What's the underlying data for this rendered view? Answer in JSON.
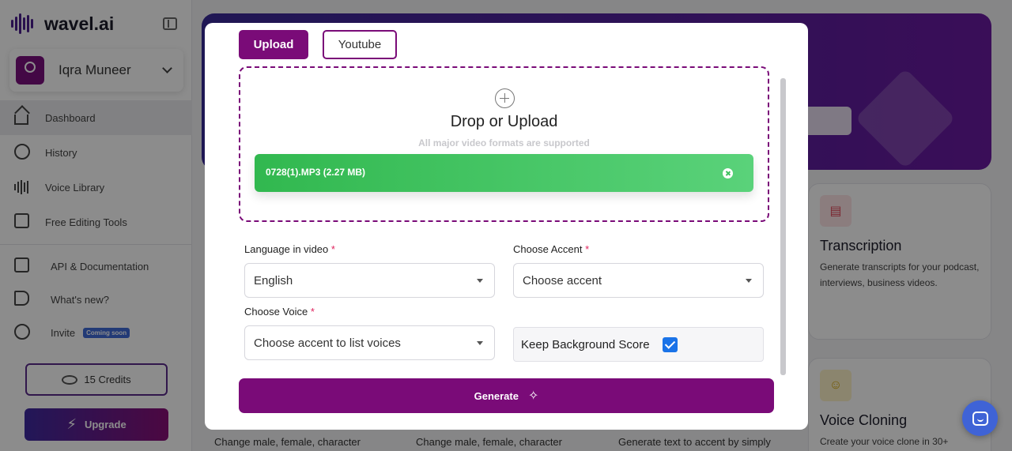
{
  "app": {
    "logo_text": "wavel.ai",
    "user_name": "Iqra Muneer",
    "nav": [
      {
        "label": "Dashboard",
        "icon": "home-icon"
      },
      {
        "label": "History",
        "icon": "history-icon"
      },
      {
        "label": "Voice Library",
        "icon": "voice-library-icon"
      },
      {
        "label": "Free Editing Tools",
        "icon": "edit-icon"
      }
    ],
    "nav2": [
      {
        "label": "API & Documentation",
        "icon": "code-file-icon"
      },
      {
        "label": "What's new?",
        "icon": "megaphone-icon"
      },
      {
        "label": "Invite",
        "icon": "invite-icon",
        "badge": "Coming soon"
      }
    ],
    "credits_label": "15 Credits",
    "upgrade_label": "Upgrade"
  },
  "cards": {
    "transcription": {
      "title": "Transcription",
      "text": "Generate transcripts for your podcast, interviews, business videos.",
      "icon": "document-icon"
    },
    "voice_cloning": {
      "title": "Voice Cloning",
      "text": "Create your voice clone in 30+",
      "icon": "people-icon"
    },
    "bottom_texts": [
      "Change male, female, character",
      "Change male, female, character",
      "Generate text to accent by simply"
    ]
  },
  "modal": {
    "tabs": {
      "upload": "Upload",
      "youtube": "Youtube"
    },
    "dropzone": {
      "title": "Drop or Upload",
      "subtitle": "All major video formats are supported",
      "file_name": "0728(1).MP3 (2.27 MB)"
    },
    "fields": {
      "language_label": "Language in video",
      "language_value": "English",
      "accent_label": "Choose Accent",
      "accent_value": "Choose accent",
      "voice_label": "Choose Voice",
      "voice_value": "Choose accent to list voices",
      "required_mark": "*",
      "keep_bg_label": "Keep Background Score",
      "keep_bg_checked": true
    },
    "generate_label": "Generate"
  },
  "colors": {
    "primary": "#7a0b78",
    "success": "#31b84f",
    "checkbox": "#1a73e8",
    "chat": "#3f63d6"
  }
}
